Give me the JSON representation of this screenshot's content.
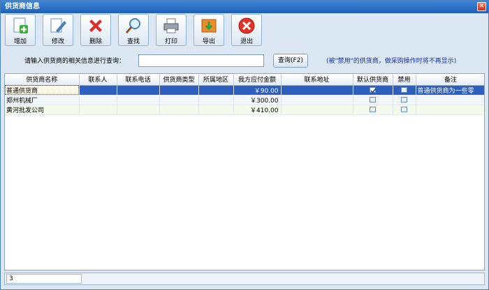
{
  "window": {
    "title": "供货商信息",
    "close": "✕"
  },
  "toolbar": [
    {
      "label": "增加",
      "icon": "add-doc-icon"
    },
    {
      "label": "修改",
      "icon": "edit-icon"
    },
    {
      "label": "删除",
      "icon": "delete-icon"
    },
    {
      "label": "查找",
      "icon": "search-icon"
    },
    {
      "label": "打印",
      "icon": "printer-icon"
    },
    {
      "label": "导出",
      "icon": "export-icon"
    },
    {
      "label": "退出",
      "icon": "exit-icon"
    }
  ],
  "search": {
    "label": "请输入供货商的相关信息进行查询：",
    "value": "",
    "button": "查询(F2)",
    "hint": "(被\"禁用\"的供货商，做采购操作时将不再显示)"
  },
  "table": {
    "columns": [
      "供货商名称",
      "联系人",
      "联系电话",
      "供货商类型",
      "所属地区",
      "我方应付金额",
      "联系地址",
      "默认供货商",
      "禁用",
      "备注"
    ],
    "rows": [
      {
        "name": "普通供货商",
        "contact": "",
        "phone": "",
        "type": "",
        "region": "",
        "amount": "￥90.00",
        "address": "",
        "default": true,
        "disabled": false,
        "note": "普通供货商为一些零"
      },
      {
        "name": "郑州机械厂",
        "contact": "",
        "phone": "",
        "type": "",
        "region": "",
        "amount": "￥300.00",
        "address": "",
        "default": false,
        "disabled": false,
        "note": ""
      },
      {
        "name": "黄河批发公司",
        "contact": "",
        "phone": "",
        "type": "",
        "region": "",
        "amount": "￥410.00",
        "address": "",
        "default": false,
        "disabled": false,
        "note": ""
      }
    ]
  },
  "status": {
    "count": "3"
  }
}
